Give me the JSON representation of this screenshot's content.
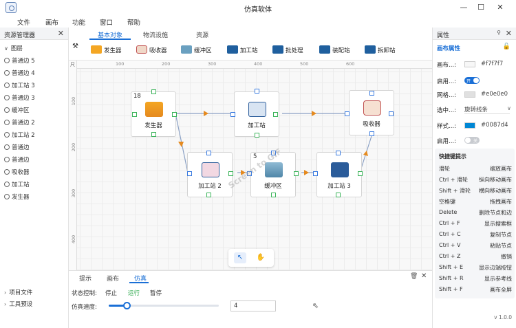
{
  "window": {
    "title": "仿真软体",
    "minimize": "—",
    "maximize": "☐",
    "close": "✕"
  },
  "menu": [
    "文件",
    "画布",
    "功能",
    "窗口",
    "帮助"
  ],
  "resource_manager": {
    "title": "资源管理器",
    "group": "图层",
    "items": [
      "普通边 5",
      "普通边 4",
      "加工站 3",
      "普通边 3",
      "缓冲区",
      "普通边 2",
      "加工站 2",
      "普通边",
      "普通边",
      "吸收器",
      "加工站",
      "发生器"
    ],
    "footer": [
      "项目文件",
      "工具预设"
    ]
  },
  "toolbox": {
    "tabs": [
      "基本对象",
      "物流设施",
      "资源"
    ],
    "tools": [
      "发生器",
      "吸收器",
      "缓冲区",
      "加工站",
      "批处理",
      "装配站",
      "拆卸站"
    ]
  },
  "canvas": {
    "ruler_corner": "尺",
    "ruler_x": [
      "100",
      "200",
      "300",
      "400",
      "500",
      "600"
    ],
    "ruler_y": [
      "100",
      "200",
      "300",
      "400"
    ],
    "nodes": [
      {
        "id": "generator",
        "label": "发生器",
        "count": "18"
      },
      {
        "id": "station1",
        "label": "加工站",
        "count": ""
      },
      {
        "id": "absorber",
        "label": "吸收器",
        "count": ""
      },
      {
        "id": "station2",
        "label": "加工站 2",
        "count": ""
      },
      {
        "id": "buffer",
        "label": "缓冲区",
        "count": "5"
      },
      {
        "id": "station3",
        "label": "加工站 3",
        "count": ""
      }
    ],
    "watermark": "Screen to GIF"
  },
  "bottom_panel": {
    "tabs": [
      "提示",
      "画布",
      "仿真"
    ],
    "state_label": "状态控制:",
    "stop": "停止",
    "run": "运行",
    "pause": "暂停",
    "speed_label": "仿真速度:",
    "speed_value": "4",
    "speed_fraction": 0.16
  },
  "properties": {
    "title": "属性",
    "section": "画布属性",
    "rows": [
      {
        "label": "画布...:",
        "value": "#f7f7f7",
        "color": "#f7f7f7"
      },
      {
        "label": "启用...:",
        "value": "开"
      },
      {
        "label": "网格...:",
        "value": "#e0e0e0",
        "color": "#e0e0e0"
      },
      {
        "label": "选中...:",
        "value": "旋转线条"
      },
      {
        "label": "样式...:",
        "value": "#0087d4",
        "color": "#0087d4"
      },
      {
        "label": "启用...:",
        "value": "关"
      }
    ],
    "hints_title": "快捷键提示",
    "hints": [
      [
        "滑轮",
        "缩放画布"
      ],
      [
        "Ctrl + 滑轮",
        "纵向移动画布"
      ],
      [
        "Shift + 滑轮",
        "横向移动画布"
      ],
      [
        "空格键",
        "拖拽画布"
      ],
      [
        "Delete",
        "删除节点和边"
      ],
      [
        "Ctrl + F",
        "显示搜索框"
      ],
      [
        "Ctrl + C",
        "复制节点"
      ],
      [
        "Ctrl + V",
        "粘贴节点"
      ],
      [
        "Ctrl + Z",
        "撤销"
      ],
      [
        "Shift + E",
        "显示边端按钮"
      ],
      [
        "Shift + R",
        "显示参考线"
      ],
      [
        "Shift + F",
        "画布全屏"
      ]
    ],
    "version": "v 1.0.0"
  },
  "colors": {
    "accent": "#1a6fd6",
    "port_in": "#3a7be0",
    "port_out": "#3bb45a",
    "arrow": "#e58a1f"
  }
}
